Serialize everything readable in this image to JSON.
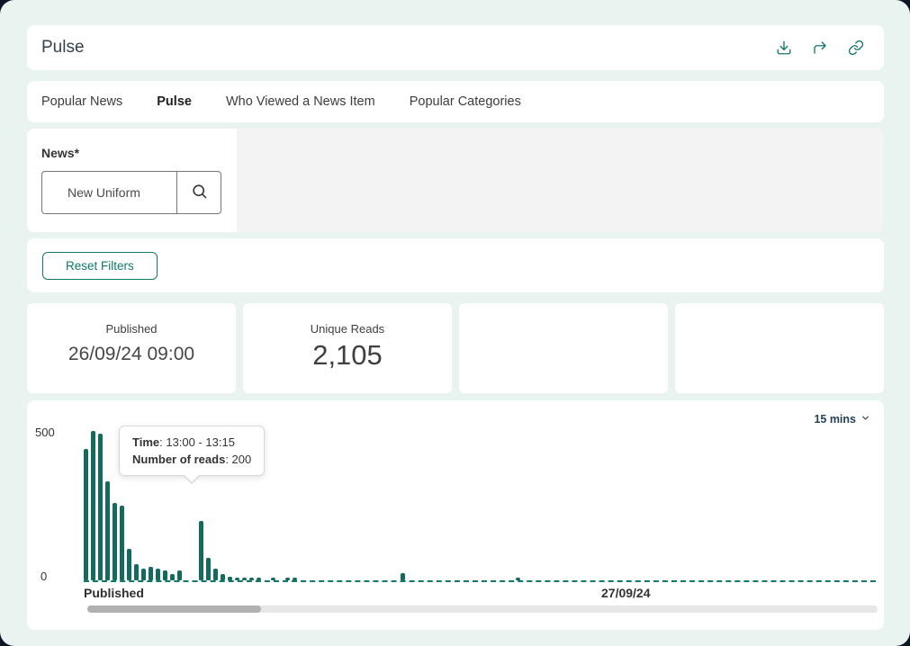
{
  "colors": {
    "accent": "#0f7a6c",
    "bar": "#136b5e",
    "background": "#e9f4f1"
  },
  "header": {
    "title": "Pulse",
    "icons": [
      "download-icon",
      "share-icon",
      "link-icon"
    ]
  },
  "tabs": {
    "active_index": 1,
    "items": [
      {
        "label": "Popular News"
      },
      {
        "label": "Pulse"
      },
      {
        "label": "Who Viewed a News Item"
      },
      {
        "label": "Popular Categories"
      }
    ]
  },
  "filters": {
    "news_label": "News*",
    "news_value": "New Uniform",
    "reset_label": "Reset Filters"
  },
  "stats": {
    "cards": [
      {
        "label": "Published",
        "value": "26/09/24 09:00"
      },
      {
        "label": "Unique Reads",
        "value": "2,105"
      },
      {
        "label": "",
        "value": ""
      },
      {
        "label": "",
        "value": ""
      }
    ]
  },
  "chart": {
    "interval": "15 mins",
    "y_max": "500",
    "y_min": "0",
    "x_start": "Published",
    "x_date": "27/09/24",
    "tooltip": {
      "time_label": "Time",
      "sep": ": ",
      "time_value": "13:00 - 13:15",
      "reads_label": "Number of reads",
      "reads_value": "200"
    }
  },
  "chart_data": {
    "type": "bar",
    "title": "Number of reads over time",
    "interval": "15 mins",
    "interval_minutes": 15,
    "ylim": [
      0,
      500
    ],
    "y_ticks": [
      0,
      500
    ],
    "x_axis_labels": [
      "Published",
      "27/09/24"
    ],
    "published_at": "26/09/24 09:00",
    "unique_reads_total": 2105,
    "highlighted_point": {
      "time": "13:00 - 13:15",
      "reads": 200
    },
    "values": [
      440,
      500,
      490,
      330,
      260,
      250,
      105,
      55,
      40,
      45,
      40,
      32,
      20,
      32,
      0,
      0,
      200,
      75,
      40,
      22,
      12,
      8,
      6,
      5,
      6,
      0,
      8,
      0,
      8,
      8,
      0,
      0,
      0,
      0,
      0,
      0,
      0,
      0,
      0,
      0,
      0,
      0,
      0,
      0,
      25,
      0,
      0,
      0,
      0,
      0,
      0,
      0,
      0,
      0,
      0,
      0,
      0,
      0,
      0,
      0,
      10,
      0,
      0,
      0,
      0,
      0,
      0,
      0,
      0,
      0,
      0,
      0,
      0,
      0,
      0,
      0,
      0,
      0,
      0,
      0,
      0,
      0,
      0,
      0,
      0,
      0,
      0,
      0,
      0,
      0,
      0,
      0,
      0,
      0,
      0,
      0,
      0,
      0,
      0,
      0,
      0,
      0,
      0,
      0,
      0,
      0,
      0,
      0,
      0,
      0
    ]
  }
}
